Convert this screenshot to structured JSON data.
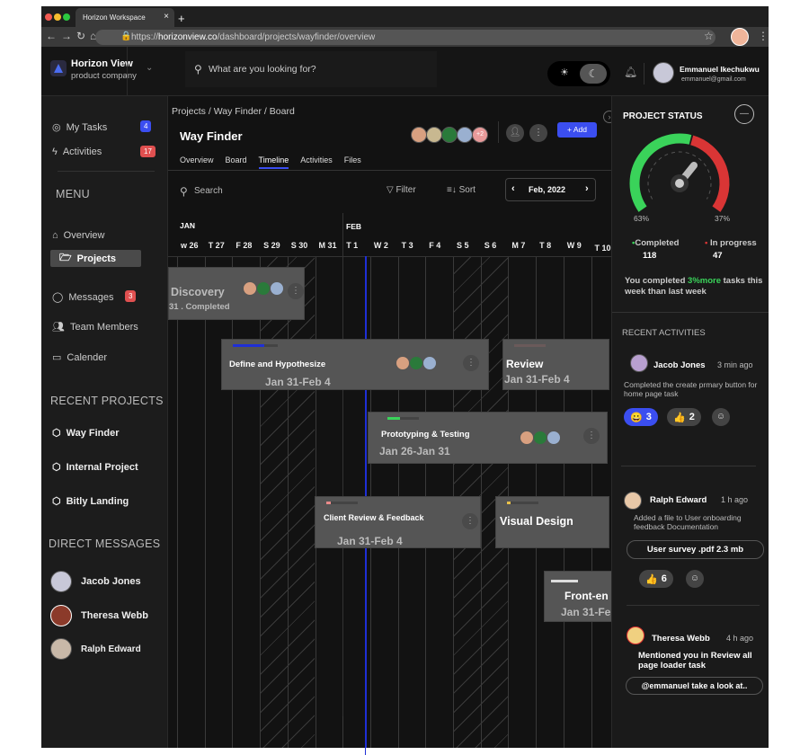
{
  "browser": {
    "tab_title": "Horizon Workspace",
    "url_prefix": "https://",
    "url_domain": "horizonview.co",
    "url_path": "/dashboard/projects/wayfinder/overview"
  },
  "header": {
    "brand": "Horizon View",
    "brand_sub": "product company",
    "search_placeholder": "What are you looking for?",
    "user_name": "Emmanuel Ikechukwu",
    "user_email": "emmanuel@gmail.com"
  },
  "sidebar": {
    "top": [
      {
        "label": "My Tasks",
        "badge": "4"
      },
      {
        "label": "Activities",
        "badge": "17"
      }
    ],
    "menu_title": "MENU",
    "menu": [
      {
        "label": "Overview"
      },
      {
        "label": "Projects"
      },
      {
        "label": "Messages",
        "badge": "3"
      },
      {
        "label": "Team Members"
      },
      {
        "label": "Calender"
      }
    ],
    "recent_title": "RECENT PROJECTS",
    "recent": [
      "Way Finder",
      "Internal Project",
      "Bitly Landing"
    ],
    "dm_title": "DIRECT  MESSAGES",
    "dms": [
      "Jacob Jones",
      "Theresa Webb",
      "Ralph Edward"
    ]
  },
  "main": {
    "breadcrumb": [
      "Projects",
      "Way Finder",
      "Board"
    ],
    "title": "Way Finder",
    "more_members": "+2",
    "add_label": "Add",
    "tabs": [
      "Overview",
      "Board",
      "Timeline",
      "Activities",
      "Files"
    ],
    "active_tab": "Timeline",
    "search_label": "Search",
    "filter_label": "Filter",
    "sort_label": "Sort",
    "month": "Feb, 2022",
    "months": [
      "JAN",
      "FEB"
    ],
    "days": [
      "w 26",
      "T 27",
      "F 28",
      "S 29",
      "S 30",
      "M 31",
      "T 1",
      "W 2",
      "T 3",
      "F 4",
      "S 5",
      "S 6",
      "M 7",
      "T 8",
      "W 9",
      "T 10"
    ],
    "tasks": [
      {
        "title": "Discovery",
        "dates": "31 .  Completed"
      },
      {
        "title": "Define and Hypothesize",
        "dates": "Jan 31-Feb 4",
        "color": "#1f2fd6",
        "progress": 0.7
      },
      {
        "title": "Review",
        "dates": "Jan 31-Feb 4",
        "color": "#6a5a5a",
        "progress": 1
      },
      {
        "title": "Prototyping & Testing",
        "dates": "Jan 26-Jan 31",
        "color": "#3ad35a",
        "progress": 0.4
      },
      {
        "title": "Client  Review & Feedback",
        "dates": "Jan 31-Feb 4",
        "color": "#e88a8a",
        "progress": 0.15
      },
      {
        "title": "Visual Design",
        "dates": "",
        "color": "#e8c04a",
        "progress": 0.1
      },
      {
        "title": "Front-en",
        "dates": "Jan 31-Fe",
        "color": "#dddddd",
        "progress": 1
      }
    ]
  },
  "status": {
    "title": "PROJECT STATUS",
    "completed_pct": "63%",
    "progress_pct": "37%",
    "completed_label": "Completed",
    "completed_count": "118",
    "progress_label": "In progress",
    "progress_count": "47",
    "msg_pre": "You completed ",
    "msg_hl": "3%more",
    "msg_post": " tasks this week than last week",
    "completed_color": "#3ad35a",
    "progress_color": "#d93535",
    "completed_fraction": 0.63
  },
  "activities": {
    "title": "RECENT ACTIVITIES",
    "items": [
      {
        "name": "Jacob Jones",
        "time": "3 min ago",
        "text": "Completed the create prmary button for home page task",
        "r1": "3",
        "r2": "2"
      },
      {
        "name": "Ralph Edward",
        "time": "1 h ago",
        "text": "Added a file to User onboarding feedback Documentation",
        "file": "User survey .pdf  2.3 mb",
        "r1": "6"
      },
      {
        "name": "Theresa Webb",
        "time": "4 h ago",
        "text": "Mentioned you in Review  all page loader task",
        "reply": "@emmanuel take a look at.."
      }
    ]
  }
}
